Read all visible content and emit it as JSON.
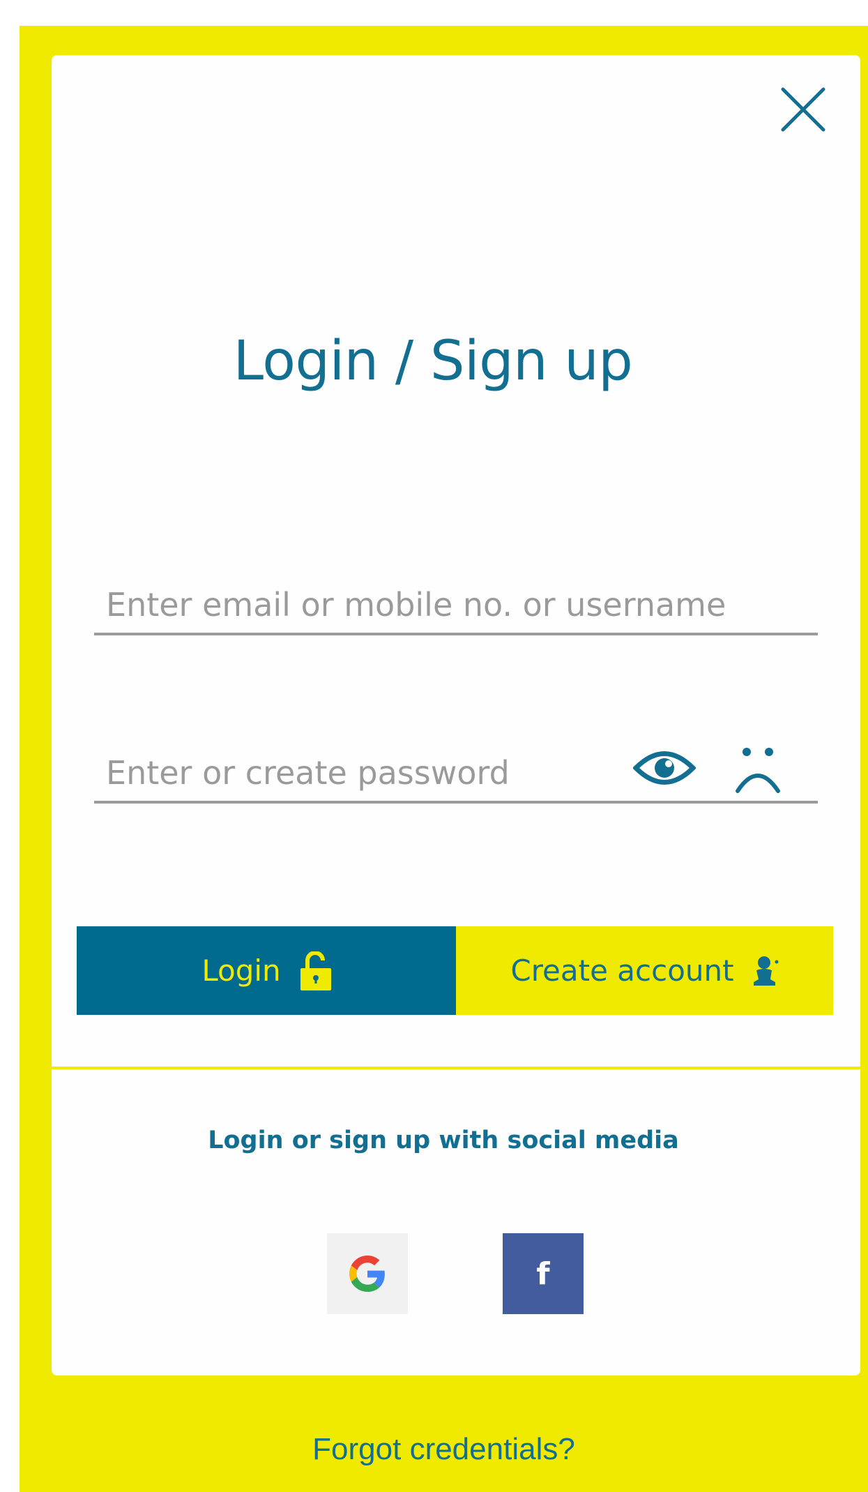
{
  "dialog": {
    "title": "Login / Sign up"
  },
  "form": {
    "email_placeholder": "Enter email or mobile no. or username",
    "email_value": "",
    "password_placeholder": "Enter or create password",
    "password_value": ""
  },
  "actions": {
    "login_label": "Login",
    "create_account_label": "Create account"
  },
  "social": {
    "title": "Login or sign up with social media",
    "facebook_letter": "f"
  },
  "footer": {
    "forgot_label": "Forgot credentials?"
  },
  "icons": {
    "close": "close-icon",
    "eye": "eye-icon",
    "sad": "sad-face-icon",
    "lock": "unlock-icon",
    "user": "user-icon",
    "google": "google-icon",
    "facebook": "facebook-icon"
  },
  "colors": {
    "brand_yellow": "#f0ea00",
    "brand_blue": "#016b8f",
    "text_blue": "#136f91",
    "facebook_blue": "#425c9e",
    "google_bg": "#f1f1f1",
    "underline_gray": "#9b9b9b"
  }
}
